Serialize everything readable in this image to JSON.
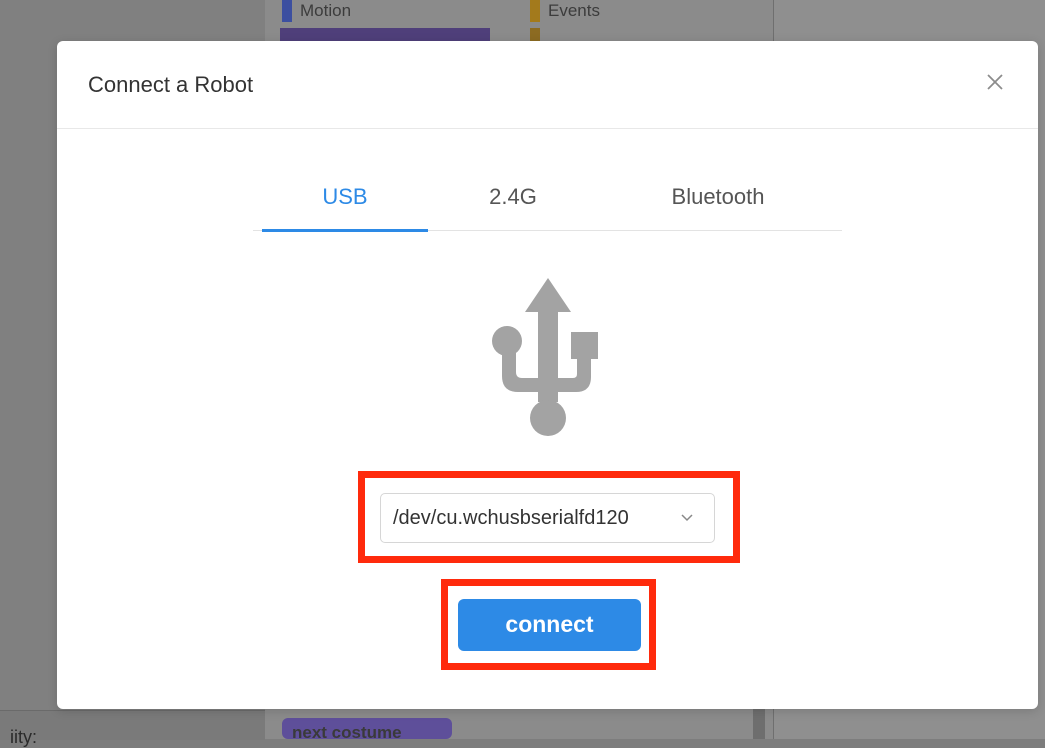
{
  "background": {
    "categories": [
      {
        "label": "Motion",
        "color": "#3c4fa0"
      },
      {
        "label": "Events",
        "color": "#a37a1c"
      }
    ],
    "bottom_text": "iity:",
    "next_costume_label": "next costume"
  },
  "modal": {
    "title": "Connect a Robot",
    "close_icon": "close-icon",
    "tabs": [
      {
        "label": "USB",
        "active": true
      },
      {
        "label": "2.4G",
        "active": false
      },
      {
        "label": "Bluetooth",
        "active": false
      }
    ],
    "usb_icon": "usb-icon",
    "port_select": {
      "value": "/dev/cu.wchusbserialfd120",
      "icon": "chevron-down-icon"
    },
    "connect_label": "connect"
  },
  "colors": {
    "accent": "#2d8ae6",
    "highlight": "#ff2a0c",
    "icon_gray": "#a3a3a3"
  }
}
